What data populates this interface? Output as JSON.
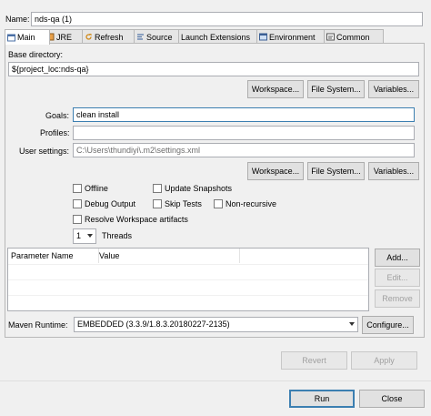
{
  "name": {
    "label": "Name:",
    "value": "nds-qa (1)"
  },
  "tabs": [
    {
      "label": "Main",
      "icon": "main-tab-icon"
    },
    {
      "label": "JRE",
      "icon": "jre-icon"
    },
    {
      "label": "Refresh",
      "icon": "refresh-icon"
    },
    {
      "label": "Source",
      "icon": "source-icon"
    },
    {
      "label": "Launch Extensions",
      "icon": ""
    },
    {
      "label": "Environment",
      "icon": "environment-icon"
    },
    {
      "label": "Common",
      "icon": "common-icon"
    }
  ],
  "base_dir": {
    "label": "Base directory:",
    "value": "${project_loc:nds-qa}"
  },
  "buttons": {
    "workspace": "Workspace...",
    "filesystem": "File System...",
    "variables": "Variables...",
    "add": "Add...",
    "edit": "Edit...",
    "remove": "Remove",
    "configure": "Configure...",
    "revert": "Revert",
    "apply": "Apply",
    "run": "Run",
    "close": "Close"
  },
  "goals": {
    "label": "Goals:",
    "value": "clean install"
  },
  "profiles": {
    "label": "Profiles:",
    "value": ""
  },
  "user_settings": {
    "label": "User settings:",
    "value": "C:\\Users\\thundiyi\\.m2\\settings.xml"
  },
  "checkboxes": {
    "offline": "Offline",
    "update_snapshots": "Update Snapshots",
    "debug_output": "Debug Output",
    "skip_tests": "Skip Tests",
    "non_recursive": "Non-recursive",
    "resolve_workspace": "Resolve Workspace artifacts"
  },
  "threads": {
    "value": "1",
    "label": "Threads"
  },
  "param_table": {
    "columns": [
      "Parameter Name",
      "Value"
    ]
  },
  "maven_runtime": {
    "label": "Maven Runtime:",
    "value": "EMBEDDED (3.3.9/1.8.3.20180227-2135)"
  },
  "colors": {
    "accent": "#3c7fb1",
    "background": "#f0f0f0"
  }
}
